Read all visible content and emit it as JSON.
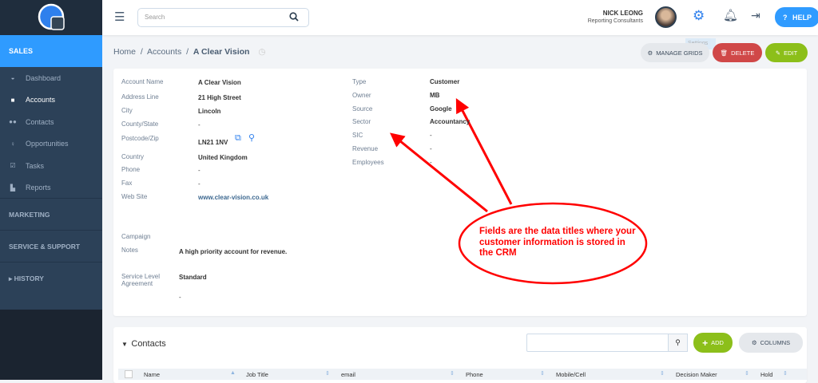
{
  "sidebar": {
    "sales": "SALES",
    "items": [
      {
        "label": "Dashboard",
        "icon": "dashboard-icon"
      },
      {
        "label": "Accounts",
        "icon": "briefcase-icon"
      },
      {
        "label": "Contacts",
        "icon": "users-icon"
      },
      {
        "label": "Opportunities",
        "icon": "lightbulb-icon"
      },
      {
        "label": "Tasks",
        "icon": "checkbox-icon"
      },
      {
        "label": "Reports",
        "icon": "reports-icon"
      }
    ],
    "marketing": "MARKETING",
    "service": "SERVICE & SUPPORT",
    "history": "HISTORY"
  },
  "topbar": {
    "search_placeholder": "Search",
    "user_name": "NICK LEONG",
    "user_company": "Reporting Consultants",
    "help": "HELP",
    "tooltip": "Settings"
  },
  "breadcrumb": {
    "home": "Home",
    "accounts": "Accounts",
    "current": "A Clear Vision"
  },
  "actions": {
    "manage_grids": "MANAGE GRIDS",
    "delete": "DELETE",
    "edit": "EDIT"
  },
  "account": {
    "left": [
      {
        "label": "Account Name",
        "value": "A Clear Vision"
      },
      {
        "label": "Address Line",
        "value": "21 High Street"
      },
      {
        "label": "City",
        "value": "Lincoln"
      },
      {
        "label": "County/State",
        "value": "-"
      },
      {
        "label": "Postcode/Zip",
        "value": "LN21 1NV"
      },
      {
        "label": "Country",
        "value": "United Kingdom"
      },
      {
        "label": "Phone",
        "value": "-"
      },
      {
        "label": "Fax",
        "value": "-"
      },
      {
        "label": "Web Site",
        "value": "www.clear-vision.co.uk"
      }
    ],
    "right": [
      {
        "label": "Type",
        "value": "Customer"
      },
      {
        "label": "Owner",
        "value": "MB"
      },
      {
        "label": "Source",
        "value": "Google"
      },
      {
        "label": "Sector",
        "value": "Accountancy"
      },
      {
        "label": "SIC",
        "value": "-"
      },
      {
        "label": "Revenue",
        "value": "-"
      },
      {
        "label": "Employees",
        "value": "-"
      }
    ],
    "campaign_label": "Campaign",
    "notes_label": "Notes",
    "notes": "A high priority account for revenue.",
    "sla_label": "Service Level Agreement",
    "sla": "Standard",
    "sla_extra": "-"
  },
  "annotation": {
    "text": "Fields are the data titles where your customer information is stored in the CRM",
    "color": "#ff0000"
  },
  "contacts": {
    "title": "Contacts",
    "add": "ADD",
    "columns": "COLUMNS",
    "headers": [
      "Name",
      "Job Title",
      "email",
      "Phone",
      "Mobile/Cell",
      "Decision Maker",
      "Hold"
    ]
  }
}
